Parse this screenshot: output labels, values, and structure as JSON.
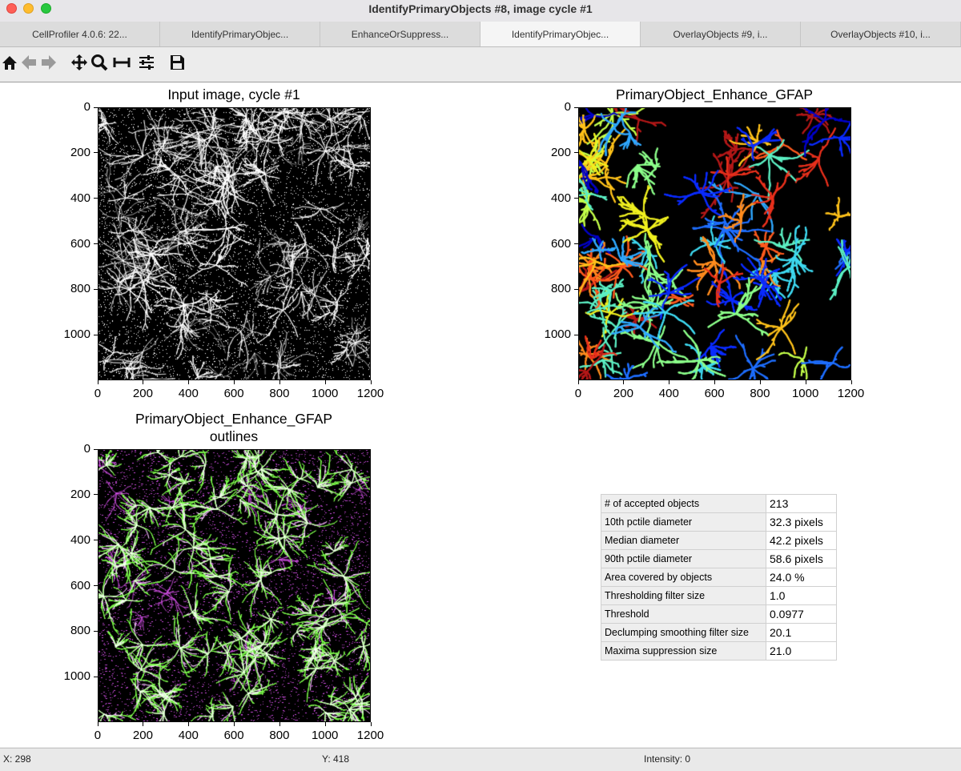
{
  "window": {
    "title": "IdentifyPrimaryObjects #8, image cycle #1"
  },
  "tabs": [
    {
      "label": "CellProfiler 4.0.6: 22...",
      "active": false
    },
    {
      "label": "IdentifyPrimaryObjec...",
      "active": false
    },
    {
      "label": "EnhanceOrSuppress...",
      "active": false
    },
    {
      "label": "IdentifyPrimaryObjec...",
      "active": true
    },
    {
      "label": "OverlayObjects #9, i...",
      "active": false
    },
    {
      "label": "OverlayObjects #10, i...",
      "active": false
    }
  ],
  "toolbar": {
    "icons": [
      "home-icon",
      "back-arrow-icon",
      "forward-arrow-icon",
      "pan-icon",
      "zoom-icon",
      "subplots-icon",
      "configure-icon",
      "save-icon"
    ]
  },
  "plots": [
    {
      "title": "Input image, cycle #1",
      "xticks": [
        "0",
        "200",
        "400",
        "600",
        "800",
        "1000",
        "1200"
      ],
      "yticks": [
        "0",
        "200",
        "400",
        "600",
        "800",
        "1000"
      ],
      "image": "grayscale-astrocytes"
    },
    {
      "title": "PrimaryObject_Enhance_GFAP",
      "xticks": [
        "0",
        "200",
        "400",
        "600",
        "800",
        "1000",
        "1200"
      ],
      "yticks": [
        "0",
        "200",
        "400",
        "600",
        "800",
        "1000"
      ],
      "image": "labeled-objects-jet"
    },
    {
      "title": "PrimaryObject_Enhance_GFAP\noutlines",
      "title_line1": "PrimaryObject_Enhance_GFAP",
      "title_line2": "outlines",
      "xticks": [
        "0",
        "200",
        "400",
        "600",
        "800",
        "1000",
        "1200"
      ],
      "yticks": [
        "0",
        "200",
        "400",
        "600",
        "800",
        "1000"
      ],
      "image": "outline-overlay"
    }
  ],
  "stats": [
    {
      "label": "# of accepted objects",
      "value": "213"
    },
    {
      "label": "10th pctile diameter",
      "value": "32.3 pixels"
    },
    {
      "label": "Median diameter",
      "value": "42.2 pixels"
    },
    {
      "label": "90th pctile diameter",
      "value": "58.6 pixels"
    },
    {
      "label": "Area covered by objects",
      "value": "24.0 %"
    },
    {
      "label": "Thresholding filter size",
      "value": "1.0"
    },
    {
      "label": "Threshold",
      "value": "0.0977"
    },
    {
      "label": "Declumping smoothing filter size",
      "value": "20.1"
    },
    {
      "label": "Maxima suppression size",
      "value": "21.0"
    }
  ],
  "status": {
    "x": "X: 298",
    "y": "Y: 418",
    "intensity": "Intensity: 0"
  },
  "colors": {
    "outline_green": "#7CFC4A",
    "outline_magenta": "#d24fe6",
    "traffic_close": "#fe5f57",
    "traffic_min": "#febc2e",
    "traffic_max": "#28c840"
  }
}
